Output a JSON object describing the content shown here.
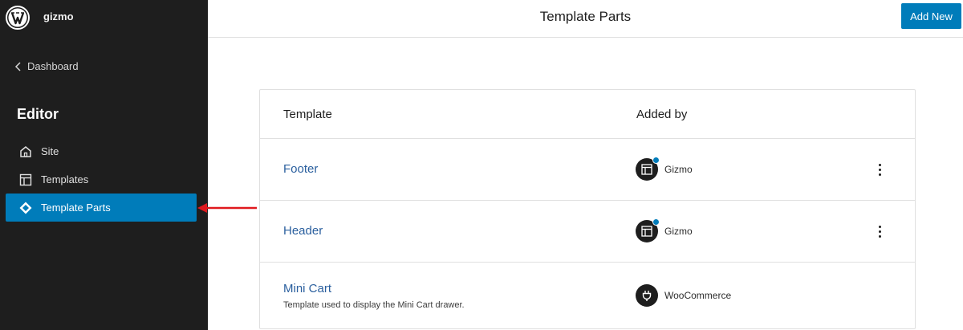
{
  "site": {
    "name": "gizmo",
    "logo_icon": "wordpress-icon"
  },
  "sidebar": {
    "back_label": "Dashboard",
    "section_title": "Editor",
    "items": [
      {
        "label": "Site",
        "icon": "home-icon",
        "active": false
      },
      {
        "label": "Templates",
        "icon": "layout-icon",
        "active": false
      },
      {
        "label": "Template Parts",
        "icon": "symbol-icon",
        "active": true
      }
    ]
  },
  "header": {
    "title": "Template Parts",
    "add_new_label": "Add New"
  },
  "table": {
    "columns": [
      "Template",
      "Added by"
    ],
    "rows": [
      {
        "title": "Footer",
        "description": "",
        "author": "Gizmo",
        "author_icon": "layout-icon",
        "has_actions": true
      },
      {
        "title": "Header",
        "description": "",
        "author": "Gizmo",
        "author_icon": "layout-icon",
        "has_actions": true
      },
      {
        "title": "Mini Cart",
        "description": "Template used to display the Mini Cart drawer.",
        "author": "WooCommerce",
        "author_icon": "plugin-icon",
        "has_actions": false
      }
    ]
  },
  "colors": {
    "sidebar_bg": "#1e1e1e",
    "accent": "#007cba",
    "link": "#2a5f9e",
    "annotation_arrow": "#e0191e"
  }
}
